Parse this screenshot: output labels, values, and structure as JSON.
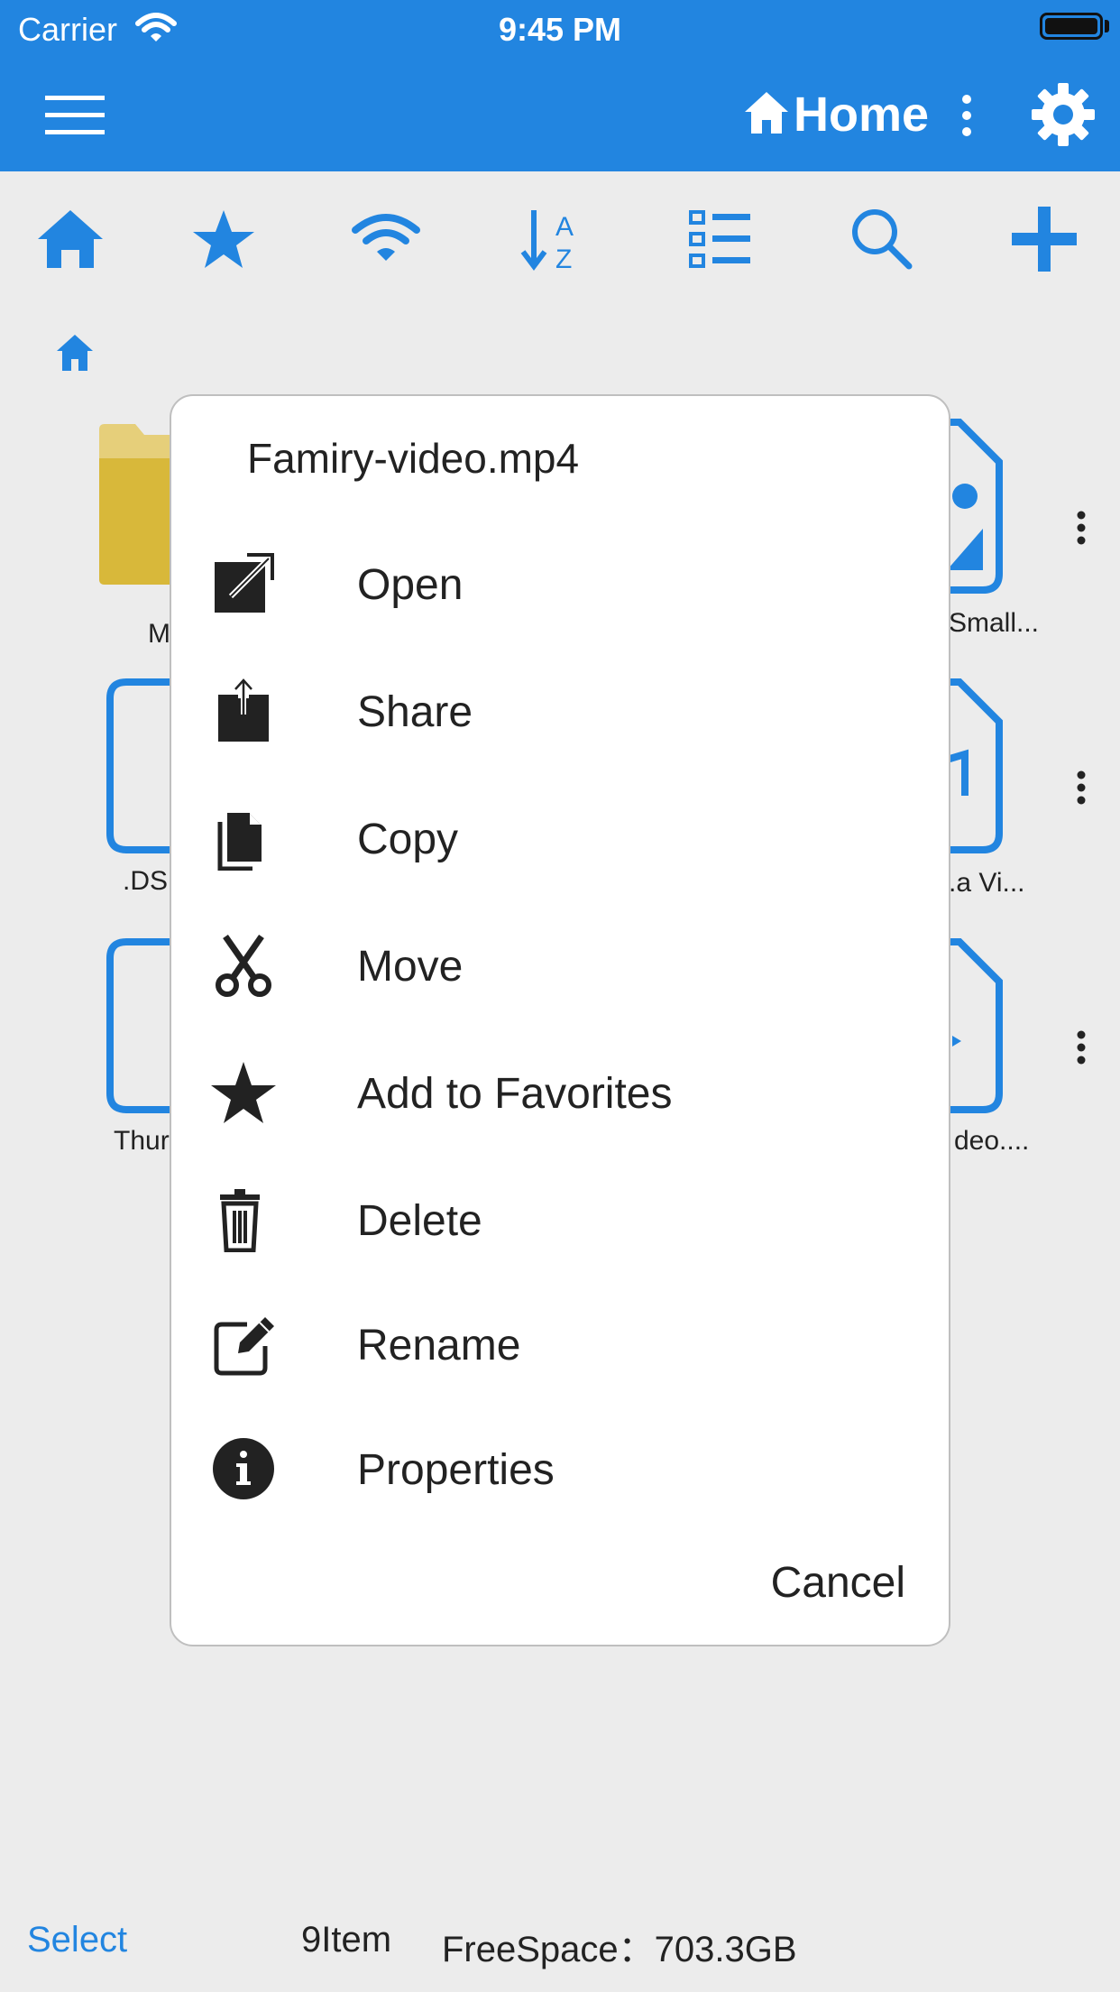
{
  "status": {
    "carrier": "Carrier",
    "time": "9:45 PM"
  },
  "nav": {
    "title": "Home"
  },
  "files": {
    "labels_left": [
      "M",
      ".DS",
      "Thur"
    ],
    "labels_right": [
      "Small...",
      ".a Vi...",
      "deo...."
    ]
  },
  "dialog": {
    "title": "Famiry-video.mp4",
    "items": [
      {
        "label": "Open",
        "icon": "open-external-icon"
      },
      {
        "label": "Share",
        "icon": "share-icon"
      },
      {
        "label": "Copy",
        "icon": "copy-icon"
      },
      {
        "label": "Move",
        "icon": "scissors-icon"
      },
      {
        "label": "Add to Favorites",
        "icon": "star-icon"
      },
      {
        "label": "Delete",
        "icon": "trash-icon"
      },
      {
        "label": " Rename",
        "icon": "edit-icon"
      },
      {
        "label": "Properties",
        "icon": "info-icon"
      }
    ],
    "cancel": "Cancel"
  },
  "bottom": {
    "select": "Select",
    "count": "9Item",
    "free": "FreeSpace：703.3GB"
  },
  "colors": {
    "accent": "#2285e0",
    "background": "#ececec"
  }
}
